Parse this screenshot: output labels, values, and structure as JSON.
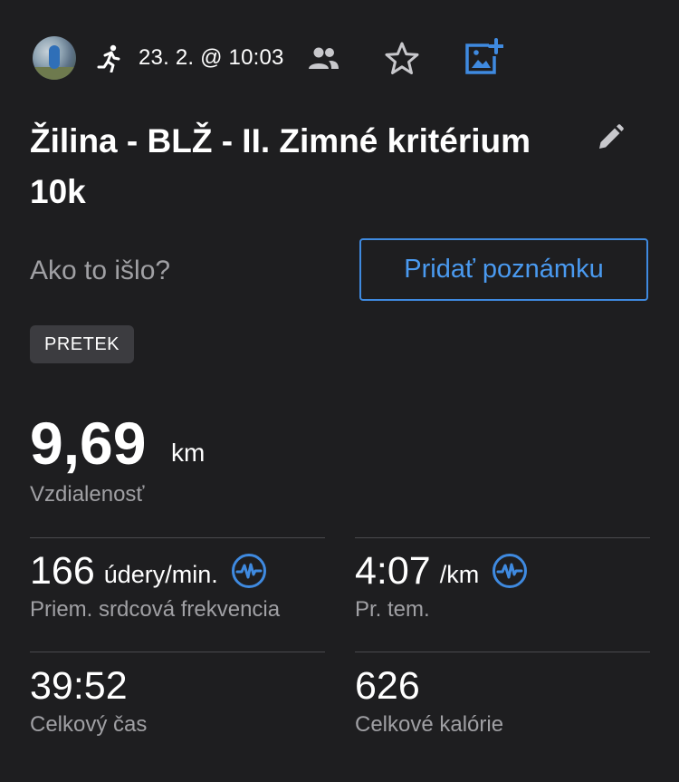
{
  "header": {
    "date": "23. 2. @ 10:03",
    "icons": [
      "avatar",
      "running-icon",
      "people-icon",
      "star-icon",
      "add-photo-icon"
    ]
  },
  "activity": {
    "title": "Žilina - BLŽ - II. Zimné kritérium 10k",
    "prompt": "Ako to išlo?",
    "add_note_label": "Pridať poznámku",
    "tag": "PRETEK"
  },
  "distance": {
    "value": "9,69",
    "unit": "km",
    "label": "Vzdialenosť"
  },
  "stats": {
    "heart_rate": {
      "value": "166",
      "unit": "údery/min.",
      "label": "Priem. srdcová frekvencia"
    },
    "pace": {
      "value": "4:07",
      "unit": "/km",
      "label": "Pr. tem."
    },
    "total_time": {
      "value": "39:52",
      "label": "Celkový čas"
    },
    "calories": {
      "value": "626",
      "label": "Celkové kalórie"
    }
  },
  "colors": {
    "background": "#1e1e20",
    "accent": "#3f8ae0",
    "secondary_text": "#a0a0a4"
  }
}
